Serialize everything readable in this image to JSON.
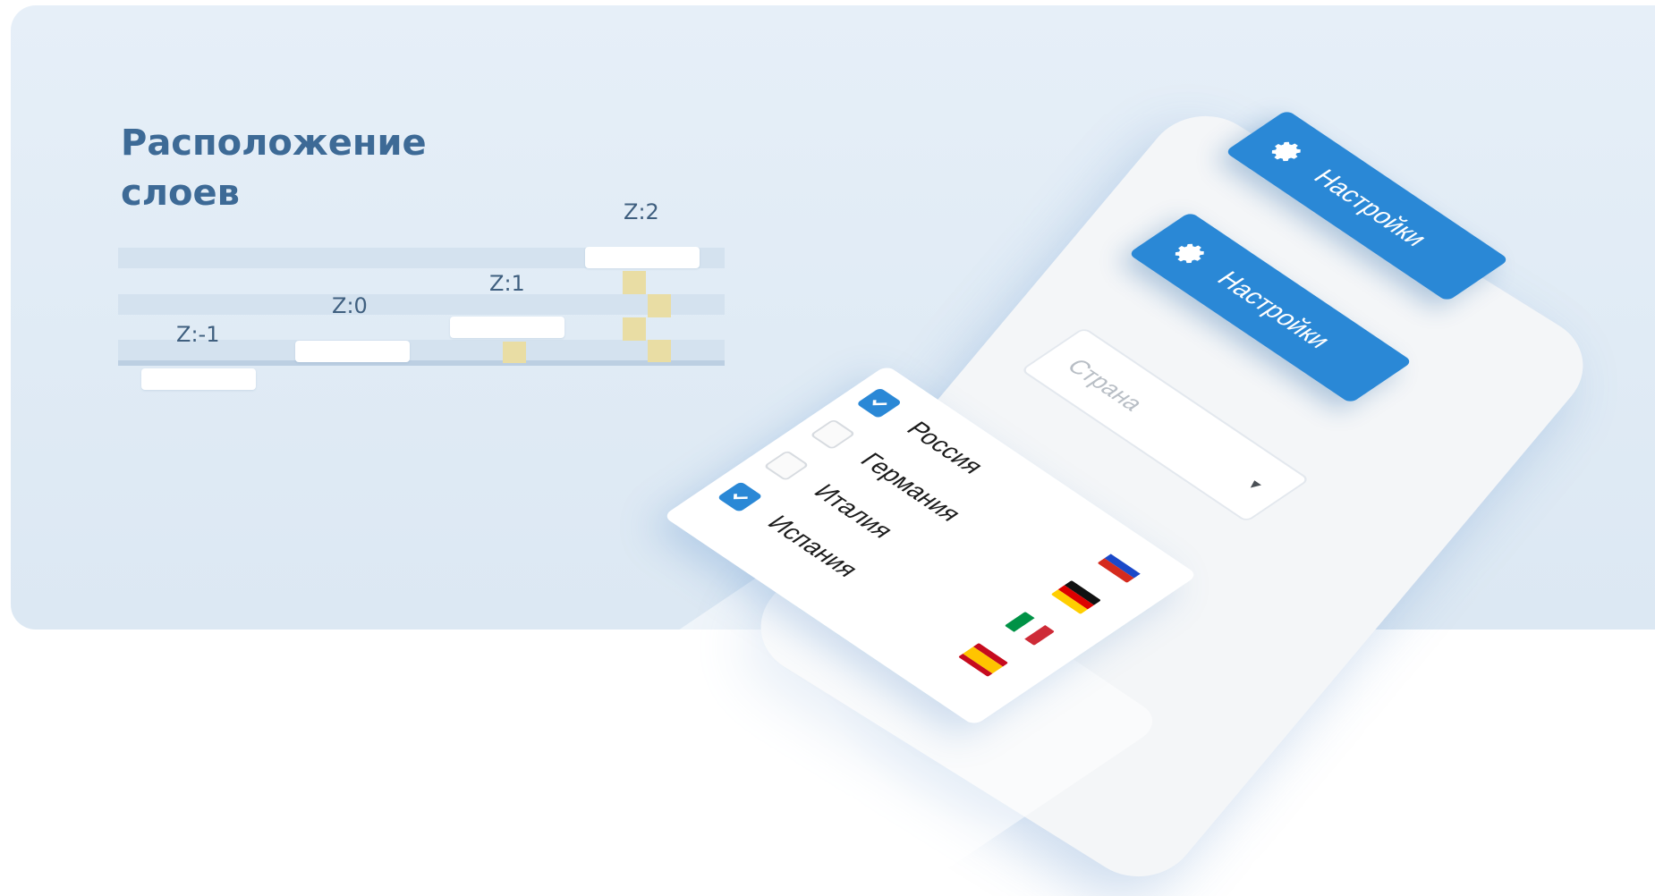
{
  "title": {
    "line1": "Расположение",
    "line2": "слоев"
  },
  "layers": {
    "z_minus_1": "Z:-1",
    "z_0": "Z:0",
    "z_1": "Z:1",
    "z_2": "Z:2"
  },
  "buttons": {
    "settings_label": "Настройки",
    "icon": "gear-icon"
  },
  "select": {
    "placeholder": "Страна",
    "caret_icon": "caret-down-icon"
  },
  "countries": [
    {
      "label": "Россия",
      "checked": true,
      "flag": "flag-russia-icon"
    },
    {
      "label": "Германия",
      "checked": false,
      "flag": "flag-germany-icon"
    },
    {
      "label": "Италия",
      "checked": false,
      "flag": "flag-italy-icon"
    },
    {
      "label": "Испания",
      "checked": true,
      "flag": "flag-spain-icon"
    }
  ],
  "colors": {
    "accent": "#2a88d6",
    "title": "#3d6a96",
    "banner": "#e2edf7",
    "pillar": "#e9dda4"
  }
}
